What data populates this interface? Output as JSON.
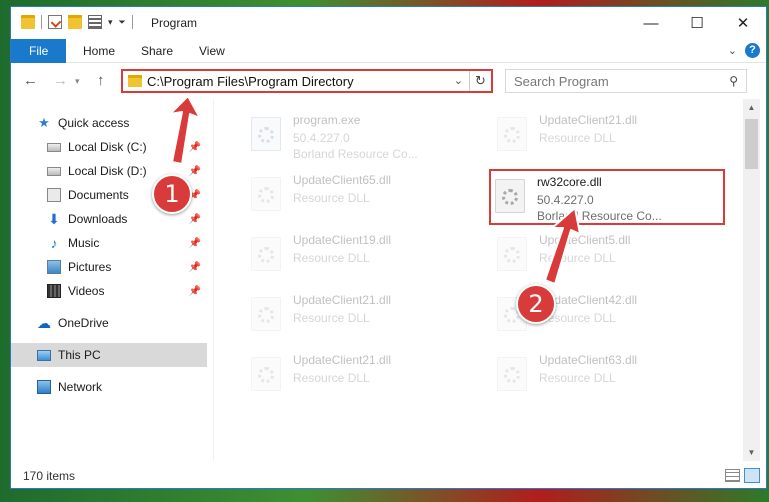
{
  "window": {
    "title": "Program",
    "controls": {
      "minimize": "—",
      "maximize": "☐",
      "close": "✕"
    }
  },
  "ribbon": {
    "tabs": [
      "File",
      "Home",
      "Share",
      "View"
    ]
  },
  "nav": {
    "address": "C:\\Program Files\\Program Directory",
    "search_placeholder": "Search Program"
  },
  "sidebar": {
    "items": [
      {
        "label": "Quick access",
        "icon": "star-icon",
        "pinned": false
      },
      {
        "label": "Local Disk (C:)",
        "icon": "disk-icon",
        "pinned": true
      },
      {
        "label": "Local Disk (D:)",
        "icon": "disk-icon",
        "pinned": true
      },
      {
        "label": "Documents",
        "icon": "documents-icon",
        "pinned": true
      },
      {
        "label": "Downloads",
        "icon": "download-icon",
        "pinned": true
      },
      {
        "label": "Music",
        "icon": "music-icon",
        "pinned": true
      },
      {
        "label": "Pictures",
        "icon": "pictures-icon",
        "pinned": true
      },
      {
        "label": "Videos",
        "icon": "videos-icon",
        "pinned": true
      },
      {
        "label": "OneDrive",
        "icon": "cloud-icon",
        "pinned": false
      },
      {
        "label": "This PC",
        "icon": "pc-icon",
        "pinned": false,
        "selected": true
      },
      {
        "label": "Network",
        "icon": "network-icon",
        "pinned": false
      }
    ]
  },
  "files": [
    {
      "name": "program.exe",
      "line2": "50.4.227.0",
      "line3": "Borland Resource Co...",
      "type": "exe",
      "faded": true
    },
    {
      "name": "UpdateClient21.dll",
      "line2": "Resource DLL",
      "line3": "",
      "type": "dll",
      "faded": true
    },
    {
      "name": "UpdateClient65.dll",
      "line2": "Resource DLL",
      "line3": "",
      "type": "dll",
      "faded": true
    },
    {
      "name": "rw32core.dll",
      "line2": "50.4.227.0",
      "line3": "Borland Resource Co...",
      "type": "dll",
      "faded": false,
      "highlighted": true
    },
    {
      "name": "UpdateClient19.dll",
      "line2": "Resource DLL",
      "line3": "",
      "type": "dll",
      "faded": true
    },
    {
      "name": "UpdateClient5.dll",
      "line2": "Resource DLL",
      "line3": "",
      "type": "dll",
      "faded": true
    },
    {
      "name": "UpdateClient21.dll",
      "line2": "Resource DLL",
      "line3": "",
      "type": "dll",
      "faded": true
    },
    {
      "name": "UpdateClient42.dll",
      "line2": "Resource DLL",
      "line3": "",
      "type": "dll",
      "faded": true
    },
    {
      "name": "UpdateClient21.dll",
      "line2": "Resource DLL",
      "line3": "",
      "type": "dll",
      "faded": true
    },
    {
      "name": "UpdateClient63.dll",
      "line2": "Resource DLL",
      "line3": "",
      "type": "dll",
      "faded": true
    }
  ],
  "status": {
    "item_count": "170 items"
  },
  "annotations": {
    "marker1": "1",
    "marker2": "2",
    "color": "#d93a3a"
  },
  "colors": {
    "accent": "#1979ca",
    "highlight_box": "#d93a3a"
  }
}
